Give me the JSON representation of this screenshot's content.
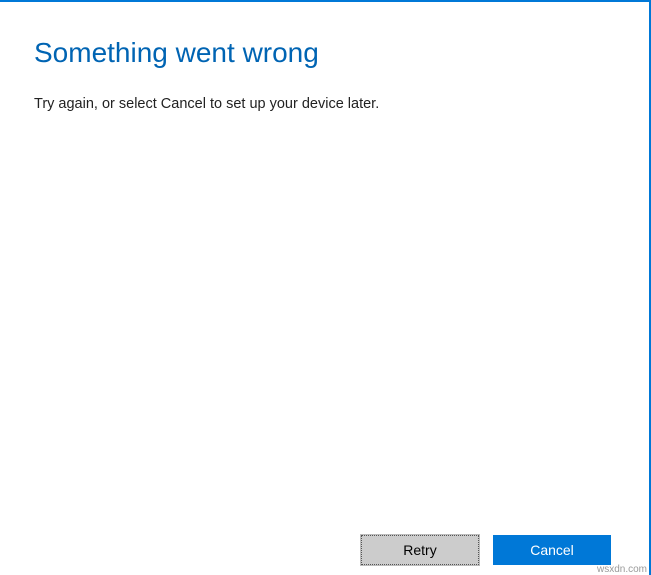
{
  "dialog": {
    "heading": "Something went wrong",
    "message": "Try again, or select Cancel to set up your device later.",
    "buttons": {
      "retry": "Retry",
      "cancel": "Cancel"
    }
  },
  "watermark": "wsxdn.com"
}
